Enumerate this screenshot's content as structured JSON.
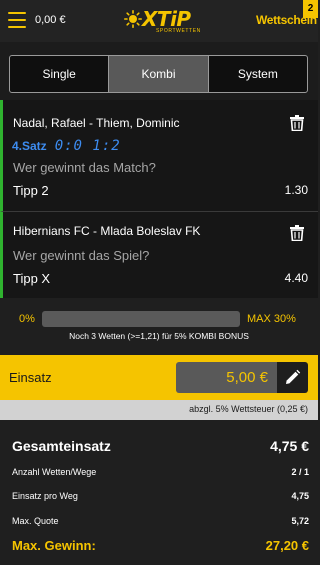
{
  "header": {
    "balance": "0,00 €",
    "logo_text": "XTiP",
    "logo_sub": "SPORTWETTEN",
    "wettschein_label": "Wettschein",
    "wettschein_count": "2"
  },
  "tabs": [
    {
      "label": "Single",
      "active": false
    },
    {
      "label": "Kombi",
      "active": true
    },
    {
      "label": "System",
      "active": false
    }
  ],
  "bets": [
    {
      "match": "Nadal, Rafael - Thiem, Dominic",
      "live_set": "4.Satz",
      "live_score": "0:0 1:2",
      "question": "Wer gewinnt das Match?",
      "tipp": "Tipp 2",
      "odds": "1.30"
    },
    {
      "match": "Hibernians FC - Mlada Boleslav FK",
      "question": "Wer gewinnt das Spiel?",
      "tipp": "Tipp X",
      "odds": "4.40"
    }
  ],
  "bonus": {
    "min_label": "0%",
    "max_label": "MAX 30%",
    "progress_fraction": 0,
    "note": "Noch 3 Wetten (>=1,21) für 5% KOMBI BONUS"
  },
  "stake": {
    "label": "Einsatz",
    "value": "5,00 €"
  },
  "tax_note": "abzgl. 5% Wettsteuer (0,25 €)",
  "summary": {
    "total_label": "Gesamteinsatz",
    "total_value": "4,75 €",
    "bets_count_label": "Anzahl Wetten/Wege",
    "bets_count_value": "2 / 1",
    "per_way_label": "Einsatz pro Weg",
    "per_way_value": "4,75",
    "max_quote_label": "Max. Quote",
    "max_quote_value": "5,72",
    "max_gain_label": "Max. Gewinn:",
    "max_gain_value": "27,20 €"
  },
  "colors": {
    "accent": "#f5c400",
    "live": "#3d8cf0",
    "selected_bar": "#2fb32f"
  }
}
